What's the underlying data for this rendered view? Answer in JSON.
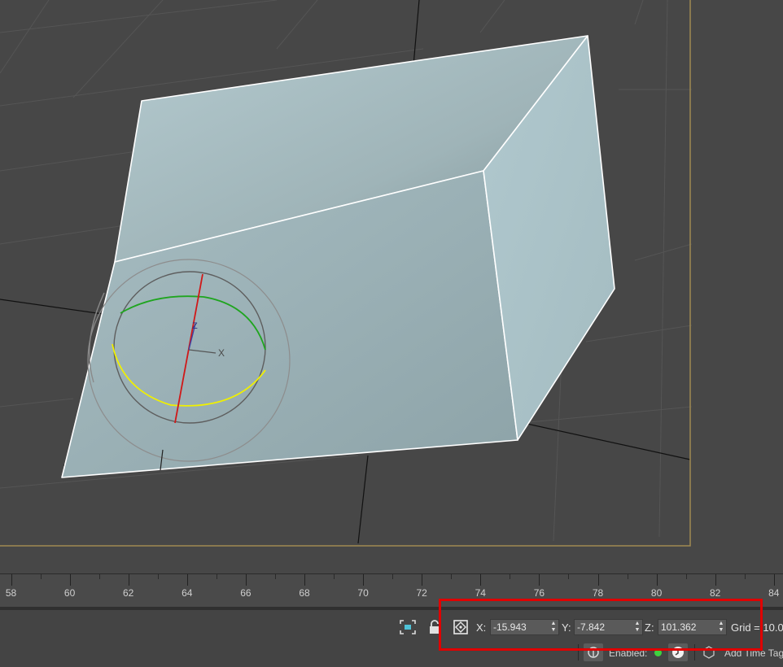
{
  "viewport": {
    "axis_label_x": "X",
    "axis_label_z": "Z"
  },
  "timeline": {
    "ticks": [
      "58",
      "60",
      "62",
      "64",
      "66",
      "68",
      "70",
      "72",
      "74",
      "76",
      "78",
      "80",
      "82",
      "84"
    ]
  },
  "coordinates": {
    "x_label": "X:",
    "x_value": "-15.943",
    "y_label": "Y:",
    "y_value": "-7.842",
    "z_label": "Z:",
    "z_value": "101.362",
    "grid_text": "Grid = 10.0"
  },
  "status": {
    "enabled_label": "Enabled:",
    "add_time_tag": "Add Time Tag"
  },
  "colors": {
    "viewport_bg": "#474747",
    "object_face": "#a9c1c6",
    "highlight": "#e00000",
    "active_border": "#a08a52",
    "enabled_dot": "#3fd13f"
  },
  "icons": [
    "selection-region-icon",
    "lock-icon",
    "transform-type-in-icon",
    "key-icon",
    "time-config-icon",
    "time-tag-icon"
  ]
}
